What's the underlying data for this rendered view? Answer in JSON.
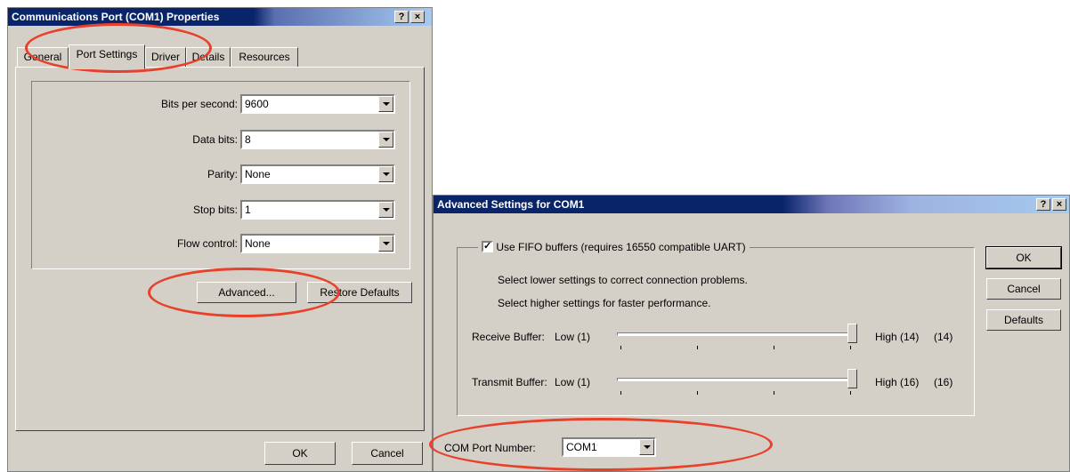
{
  "left_dialog": {
    "title": "Communications Port (COM1) Properties",
    "help_button": "?",
    "close_button": "×",
    "tabs": [
      "General",
      "Port Settings",
      "Driver",
      "Details",
      "Resources"
    ],
    "active_tab": "Port Settings",
    "fields": [
      {
        "label": "Bits per second:",
        "value": "9600"
      },
      {
        "label": "Data bits:",
        "value": "8"
      },
      {
        "label": "Parity:",
        "value": "None"
      },
      {
        "label": "Stop bits:",
        "value": "1"
      },
      {
        "label": "Flow control:",
        "value": "None"
      }
    ],
    "advanced_button": "Advanced...",
    "restore_button": "Restore Defaults",
    "ok_button": "OK",
    "cancel_button": "Cancel"
  },
  "right_dialog": {
    "title": "Advanced Settings for COM1",
    "help_button": "?",
    "close_button": "×",
    "fifo_checkbox": {
      "label": "Use FIFO buffers (requires 16550 compatible UART)",
      "checked": true
    },
    "hint_lower": "Select lower settings to correct connection problems.",
    "hint_higher": "Select higher settings for faster performance.",
    "receive": {
      "label": "Receive Buffer:",
      "low": "Low (1)",
      "high": "High (14)",
      "current": "(14)",
      "level": 1.0
    },
    "transmit": {
      "label": "Transmit Buffer:",
      "low": "Low (1)",
      "high": "High (16)",
      "current": "(16)",
      "level": 1.0
    },
    "com_port_label": "COM Port Number:",
    "com_port_value": "COM1",
    "ok_button": "OK",
    "cancel_button": "Cancel",
    "defaults_button": "Defaults"
  },
  "annotation_color": "#e8402a"
}
